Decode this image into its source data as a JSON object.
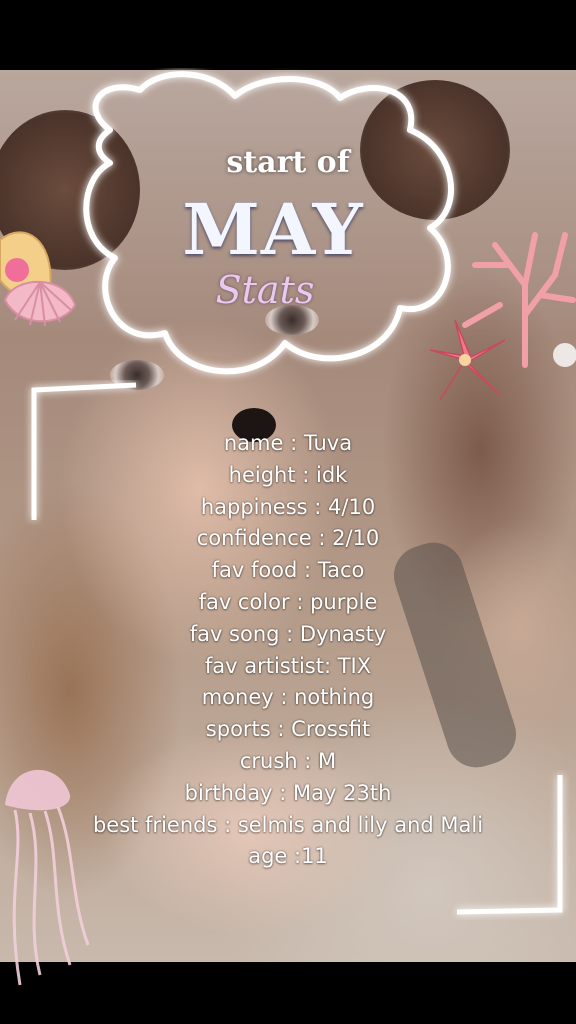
{
  "header": {
    "start_label": "start of",
    "month": "MAY",
    "subtitle": "Stats"
  },
  "stats": [
    {
      "text": "name : Tuva"
    },
    {
      "text": "height : idk"
    },
    {
      "text": "happiness : 4/10"
    },
    {
      "text": "confidence : 2/10"
    },
    {
      "text": "fav food : Taco"
    },
    {
      "text": "fav color : purple"
    },
    {
      "text": "fav song : Dynasty"
    },
    {
      "text": "fav artistist: TIX"
    },
    {
      "text": "money : nothing"
    },
    {
      "text": "sports : Crossfit"
    },
    {
      "text": "crush : M"
    },
    {
      "text": "birthday : May 23th"
    },
    {
      "text": "best friends : selmis and lily and Mali"
    },
    {
      "text": "age :11"
    }
  ],
  "stickers": {
    "top_left": "seashell-icon",
    "top_right": "pink-coral-icon",
    "flower": "lily-flower-icon",
    "bottom_left": "jellyfish-icon"
  },
  "colors": {
    "neon_frame": "#ffffff",
    "stats_title": "#e8c9f0",
    "coral": "#f2a0a8"
  }
}
